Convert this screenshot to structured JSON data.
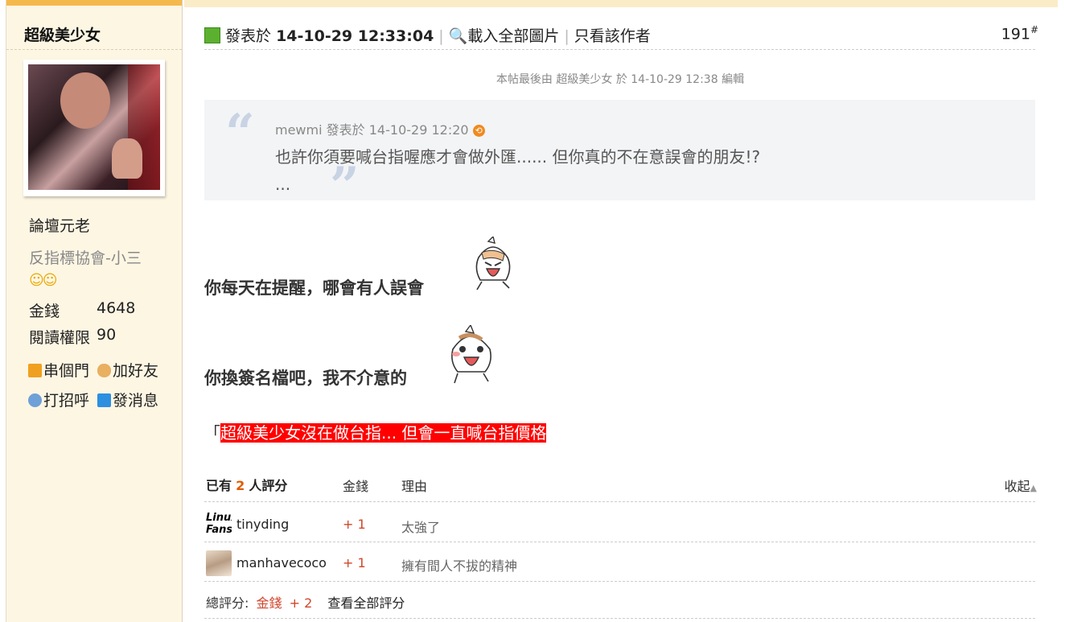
{
  "sidebar": {
    "username": "超級美少女",
    "rank": "論壇元老",
    "title": "反指標協會-小三",
    "smileys": "☺☺",
    "stats": [
      {
        "label": "金錢",
        "value": "4648"
      },
      {
        "label": "閱讀權限",
        "value": "90"
      }
    ],
    "actions": [
      {
        "label": "串個門",
        "icon": "home-icon"
      },
      {
        "label": "加好友",
        "icon": "handshake-icon"
      },
      {
        "label": "打招呼",
        "icon": "wave-user-icon"
      },
      {
        "label": "發消息",
        "icon": "mail-icon"
      }
    ]
  },
  "post": {
    "posted_label": "發表於",
    "posted_time": "14-10-29 12:33:04",
    "load_images": "載入全部圖片",
    "only_author": "只看該作者",
    "floor": "191",
    "floor_mark": "#",
    "edited_note": "本帖最後由 超級美少女 於 14-10-29 12:38 編輯",
    "quote": {
      "author": "mewmi",
      "posted_label": "發表於",
      "time": "14-10-29 12:20",
      "jump": "⟲",
      "text": "也許你須要喊台指喔應才會做外匯...... 但你真的不在意誤會的朋友!?",
      "ellipsis": "...",
      "open_mark": "“",
      "close_mark": "”"
    },
    "body_line1": "你每天在提醒，哪會有人誤會",
    "body_line2": "你換簽名檔吧，我不介意的",
    "signature_prefix": "「",
    "signature_text": "超級美少女沒在做台指... 但會一直喊台指價格"
  },
  "rating": {
    "head_prefix": "已有",
    "count": "2",
    "head_suffix": "人評分",
    "col_money": "金錢",
    "col_reason": "理由",
    "collapse": "收起",
    "rows": [
      {
        "avatar": "Linux Fans",
        "name": "tinyding",
        "money": "+ 1",
        "reason": "太強了"
      },
      {
        "avatar": "cat",
        "name": "manhavecoco",
        "money": "+ 1",
        "reason": "擁有間人不拔的精神"
      }
    ],
    "total_label": "總評分:",
    "total_currency": "金錢",
    "total_value": "+ 2",
    "view_all": "查看全部評分"
  },
  "colors": {
    "accent": "#f5b94b",
    "sidebar_bg": "#fdf6e3",
    "highlight": "#ff0000",
    "score": "#d0462c"
  }
}
